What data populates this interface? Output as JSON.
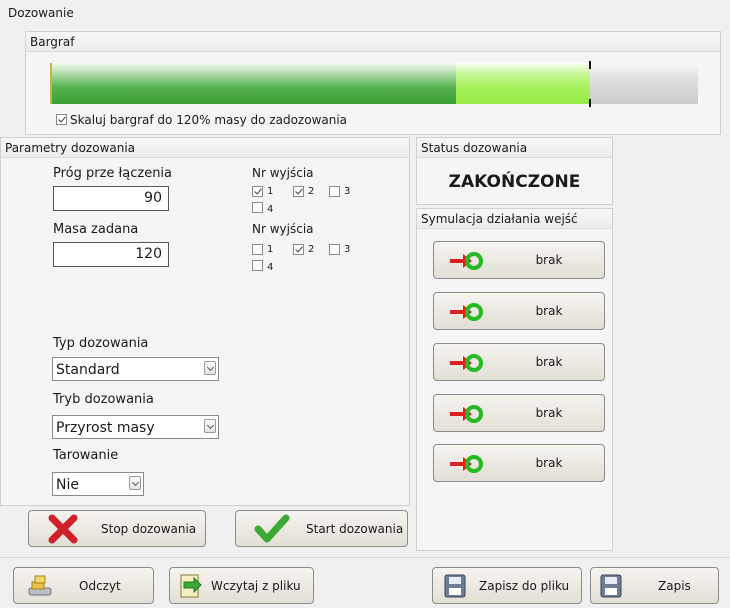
{
  "window_title": "Dozowanie",
  "bargraf": {
    "title": "Bargraf",
    "scale_checkbox_checked": true,
    "scale_checkbox_label": "Skaluj bargraf do 120% masy do zadozowania"
  },
  "params": {
    "title": "Parametry dozowania",
    "threshold_label": "Próg prze łączenia",
    "threshold_value": "90",
    "mass_label": "Masa zadana",
    "mass_value": "120",
    "outputs_label_1": "Nr wyjścia",
    "outputs_label_2": "Nr wyjścia",
    "outputs_1": [
      {
        "label": "1",
        "checked": true
      },
      {
        "label": "2",
        "checked": true
      },
      {
        "label": "3",
        "checked": false
      },
      {
        "label": "4",
        "checked": false
      }
    ],
    "outputs_2": [
      {
        "label": "1",
        "checked": false
      },
      {
        "label": "2",
        "checked": true
      },
      {
        "label": "3",
        "checked": false
      },
      {
        "label": "4",
        "checked": false
      }
    ],
    "dosing_type_label": "Typ dozowania",
    "dosing_type_value": "Standard",
    "dosing_mode_label": "Tryb dozowania",
    "dosing_mode_value": "Przyrost masy",
    "taring_label": "Tarowanie",
    "taring_value": "Nie",
    "stop_button": "Stop dozowania",
    "start_button": "Start dozowania"
  },
  "status": {
    "title": "Status dozowania",
    "value": "ZAKOŃCZONE"
  },
  "simulation": {
    "title": "Symulacja działania wejść",
    "buttons": [
      "brak",
      "brak",
      "brak",
      "brak",
      "brak"
    ]
  },
  "footer": {
    "read_button": "Odczyt",
    "load_file_button": "Wczytaj z pliku",
    "save_file_button": "Zapisz do pliku",
    "save_button": "Zapis"
  },
  "colors": {
    "bar_dark_green": "#3fa83a",
    "bar_light_green": "#a8f25a",
    "bar_gray": "#cfcfcf",
    "stop_icon_red": "#d0202a",
    "start_icon_green": "#3aaa35"
  }
}
